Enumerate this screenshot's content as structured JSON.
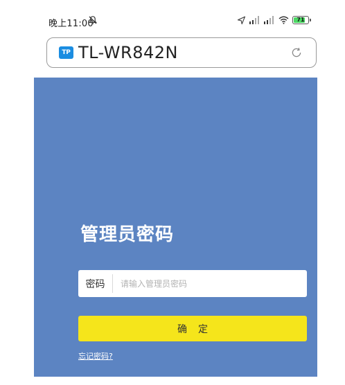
{
  "status_bar": {
    "time": "晚上11:00",
    "battery_level": "71",
    "battery_fraction": 0.71,
    "battery_color": "#4cd964",
    "icons": [
      "mute-icon",
      "location-icon",
      "signal-icon",
      "signal-icon",
      "wifi-icon",
      "battery-icon"
    ]
  },
  "browser": {
    "site_logo": "TP",
    "url": "TL-WR842N",
    "refresh_icon": "refresh-icon"
  },
  "login": {
    "title": "管理员密码",
    "password_label": "密码",
    "password_placeholder": "请输入管理员密码",
    "password_value": "",
    "confirm_label": "确定",
    "forgot_password": "忘记密码?",
    "panel_color": "#5c84c2",
    "button_color": "#f5e51b"
  }
}
